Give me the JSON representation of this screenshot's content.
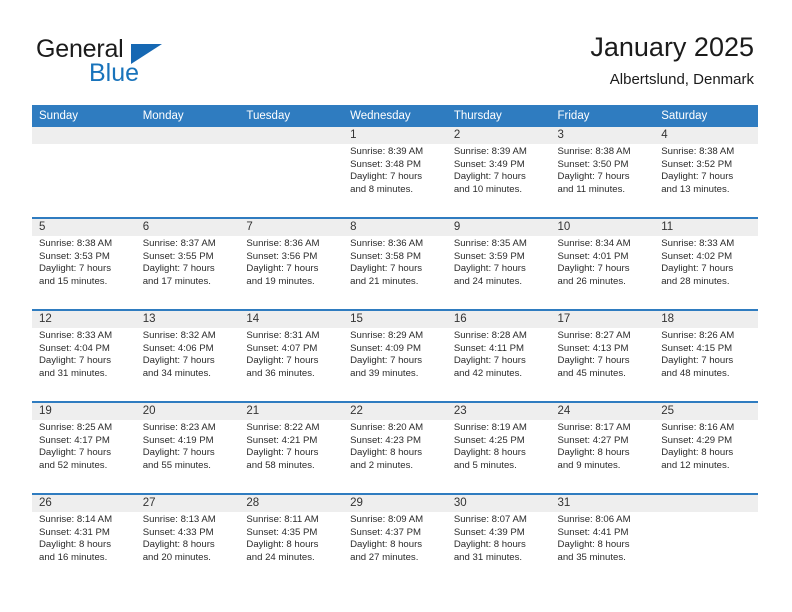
{
  "brand": {
    "line1": "General",
    "line2": "Blue",
    "triangle_color": "#1668b3",
    "line2_color": "#1873bb"
  },
  "header": {
    "title": "January 2025",
    "subtitle": "Albertslund, Denmark"
  },
  "theme": {
    "header_bg": "#2f7cc0",
    "daynum_bg": "#eeeeee",
    "cell_bg": "#ffffff",
    "text": "#2b2b2b"
  },
  "calendar": {
    "weekday_headers": [
      "Sunday",
      "Monday",
      "Tuesday",
      "Wednesday",
      "Thursday",
      "Friday",
      "Saturday"
    ],
    "labels": {
      "sunrise": "Sunrise:",
      "sunset": "Sunset:",
      "daylight": "Daylight:"
    },
    "weeks": [
      [
        {
          "day": "",
          "empty": true
        },
        {
          "day": "",
          "empty": true
        },
        {
          "day": "",
          "empty": true
        },
        {
          "day": "1",
          "sunrise": "Sunrise: 8:39 AM",
          "sunset": "Sunset: 3:48 PM",
          "daylight1": "Daylight: 7 hours",
          "daylight2": "and 8 minutes."
        },
        {
          "day": "2",
          "sunrise": "Sunrise: 8:39 AM",
          "sunset": "Sunset: 3:49 PM",
          "daylight1": "Daylight: 7 hours",
          "daylight2": "and 10 minutes."
        },
        {
          "day": "3",
          "sunrise": "Sunrise: 8:38 AM",
          "sunset": "Sunset: 3:50 PM",
          "daylight1": "Daylight: 7 hours",
          "daylight2": "and 11 minutes."
        },
        {
          "day": "4",
          "sunrise": "Sunrise: 8:38 AM",
          "sunset": "Sunset: 3:52 PM",
          "daylight1": "Daylight: 7 hours",
          "daylight2": "and 13 minutes."
        }
      ],
      [
        {
          "day": "5",
          "sunrise": "Sunrise: 8:38 AM",
          "sunset": "Sunset: 3:53 PM",
          "daylight1": "Daylight: 7 hours",
          "daylight2": "and 15 minutes."
        },
        {
          "day": "6",
          "sunrise": "Sunrise: 8:37 AM",
          "sunset": "Sunset: 3:55 PM",
          "daylight1": "Daylight: 7 hours",
          "daylight2": "and 17 minutes."
        },
        {
          "day": "7",
          "sunrise": "Sunrise: 8:36 AM",
          "sunset": "Sunset: 3:56 PM",
          "daylight1": "Daylight: 7 hours",
          "daylight2": "and 19 minutes."
        },
        {
          "day": "8",
          "sunrise": "Sunrise: 8:36 AM",
          "sunset": "Sunset: 3:58 PM",
          "daylight1": "Daylight: 7 hours",
          "daylight2": "and 21 minutes."
        },
        {
          "day": "9",
          "sunrise": "Sunrise: 8:35 AM",
          "sunset": "Sunset: 3:59 PM",
          "daylight1": "Daylight: 7 hours",
          "daylight2": "and 24 minutes."
        },
        {
          "day": "10",
          "sunrise": "Sunrise: 8:34 AM",
          "sunset": "Sunset: 4:01 PM",
          "daylight1": "Daylight: 7 hours",
          "daylight2": "and 26 minutes."
        },
        {
          "day": "11",
          "sunrise": "Sunrise: 8:33 AM",
          "sunset": "Sunset: 4:02 PM",
          "daylight1": "Daylight: 7 hours",
          "daylight2": "and 28 minutes."
        }
      ],
      [
        {
          "day": "12",
          "sunrise": "Sunrise: 8:33 AM",
          "sunset": "Sunset: 4:04 PM",
          "daylight1": "Daylight: 7 hours",
          "daylight2": "and 31 minutes."
        },
        {
          "day": "13",
          "sunrise": "Sunrise: 8:32 AM",
          "sunset": "Sunset: 4:06 PM",
          "daylight1": "Daylight: 7 hours",
          "daylight2": "and 34 minutes."
        },
        {
          "day": "14",
          "sunrise": "Sunrise: 8:31 AM",
          "sunset": "Sunset: 4:07 PM",
          "daylight1": "Daylight: 7 hours",
          "daylight2": "and 36 minutes."
        },
        {
          "day": "15",
          "sunrise": "Sunrise: 8:29 AM",
          "sunset": "Sunset: 4:09 PM",
          "daylight1": "Daylight: 7 hours",
          "daylight2": "and 39 minutes."
        },
        {
          "day": "16",
          "sunrise": "Sunrise: 8:28 AM",
          "sunset": "Sunset: 4:11 PM",
          "daylight1": "Daylight: 7 hours",
          "daylight2": "and 42 minutes."
        },
        {
          "day": "17",
          "sunrise": "Sunrise: 8:27 AM",
          "sunset": "Sunset: 4:13 PM",
          "daylight1": "Daylight: 7 hours",
          "daylight2": "and 45 minutes."
        },
        {
          "day": "18",
          "sunrise": "Sunrise: 8:26 AM",
          "sunset": "Sunset: 4:15 PM",
          "daylight1": "Daylight: 7 hours",
          "daylight2": "and 48 minutes."
        }
      ],
      [
        {
          "day": "19",
          "sunrise": "Sunrise: 8:25 AM",
          "sunset": "Sunset: 4:17 PM",
          "daylight1": "Daylight: 7 hours",
          "daylight2": "and 52 minutes."
        },
        {
          "day": "20",
          "sunrise": "Sunrise: 8:23 AM",
          "sunset": "Sunset: 4:19 PM",
          "daylight1": "Daylight: 7 hours",
          "daylight2": "and 55 minutes."
        },
        {
          "day": "21",
          "sunrise": "Sunrise: 8:22 AM",
          "sunset": "Sunset: 4:21 PM",
          "daylight1": "Daylight: 7 hours",
          "daylight2": "and 58 minutes."
        },
        {
          "day": "22",
          "sunrise": "Sunrise: 8:20 AM",
          "sunset": "Sunset: 4:23 PM",
          "daylight1": "Daylight: 8 hours",
          "daylight2": "and 2 minutes."
        },
        {
          "day": "23",
          "sunrise": "Sunrise: 8:19 AM",
          "sunset": "Sunset: 4:25 PM",
          "daylight1": "Daylight: 8 hours",
          "daylight2": "and 5 minutes."
        },
        {
          "day": "24",
          "sunrise": "Sunrise: 8:17 AM",
          "sunset": "Sunset: 4:27 PM",
          "daylight1": "Daylight: 8 hours",
          "daylight2": "and 9 minutes."
        },
        {
          "day": "25",
          "sunrise": "Sunrise: 8:16 AM",
          "sunset": "Sunset: 4:29 PM",
          "daylight1": "Daylight: 8 hours",
          "daylight2": "and 12 minutes."
        }
      ],
      [
        {
          "day": "26",
          "sunrise": "Sunrise: 8:14 AM",
          "sunset": "Sunset: 4:31 PM",
          "daylight1": "Daylight: 8 hours",
          "daylight2": "and 16 minutes."
        },
        {
          "day": "27",
          "sunrise": "Sunrise: 8:13 AM",
          "sunset": "Sunset: 4:33 PM",
          "daylight1": "Daylight: 8 hours",
          "daylight2": "and 20 minutes."
        },
        {
          "day": "28",
          "sunrise": "Sunrise: 8:11 AM",
          "sunset": "Sunset: 4:35 PM",
          "daylight1": "Daylight: 8 hours",
          "daylight2": "and 24 minutes."
        },
        {
          "day": "29",
          "sunrise": "Sunrise: 8:09 AM",
          "sunset": "Sunset: 4:37 PM",
          "daylight1": "Daylight: 8 hours",
          "daylight2": "and 27 minutes."
        },
        {
          "day": "30",
          "sunrise": "Sunrise: 8:07 AM",
          "sunset": "Sunset: 4:39 PM",
          "daylight1": "Daylight: 8 hours",
          "daylight2": "and 31 minutes."
        },
        {
          "day": "31",
          "sunrise": "Sunrise: 8:06 AM",
          "sunset": "Sunset: 4:41 PM",
          "daylight1": "Daylight: 8 hours",
          "daylight2": "and 35 minutes."
        },
        {
          "day": "",
          "empty": true
        }
      ]
    ]
  }
}
